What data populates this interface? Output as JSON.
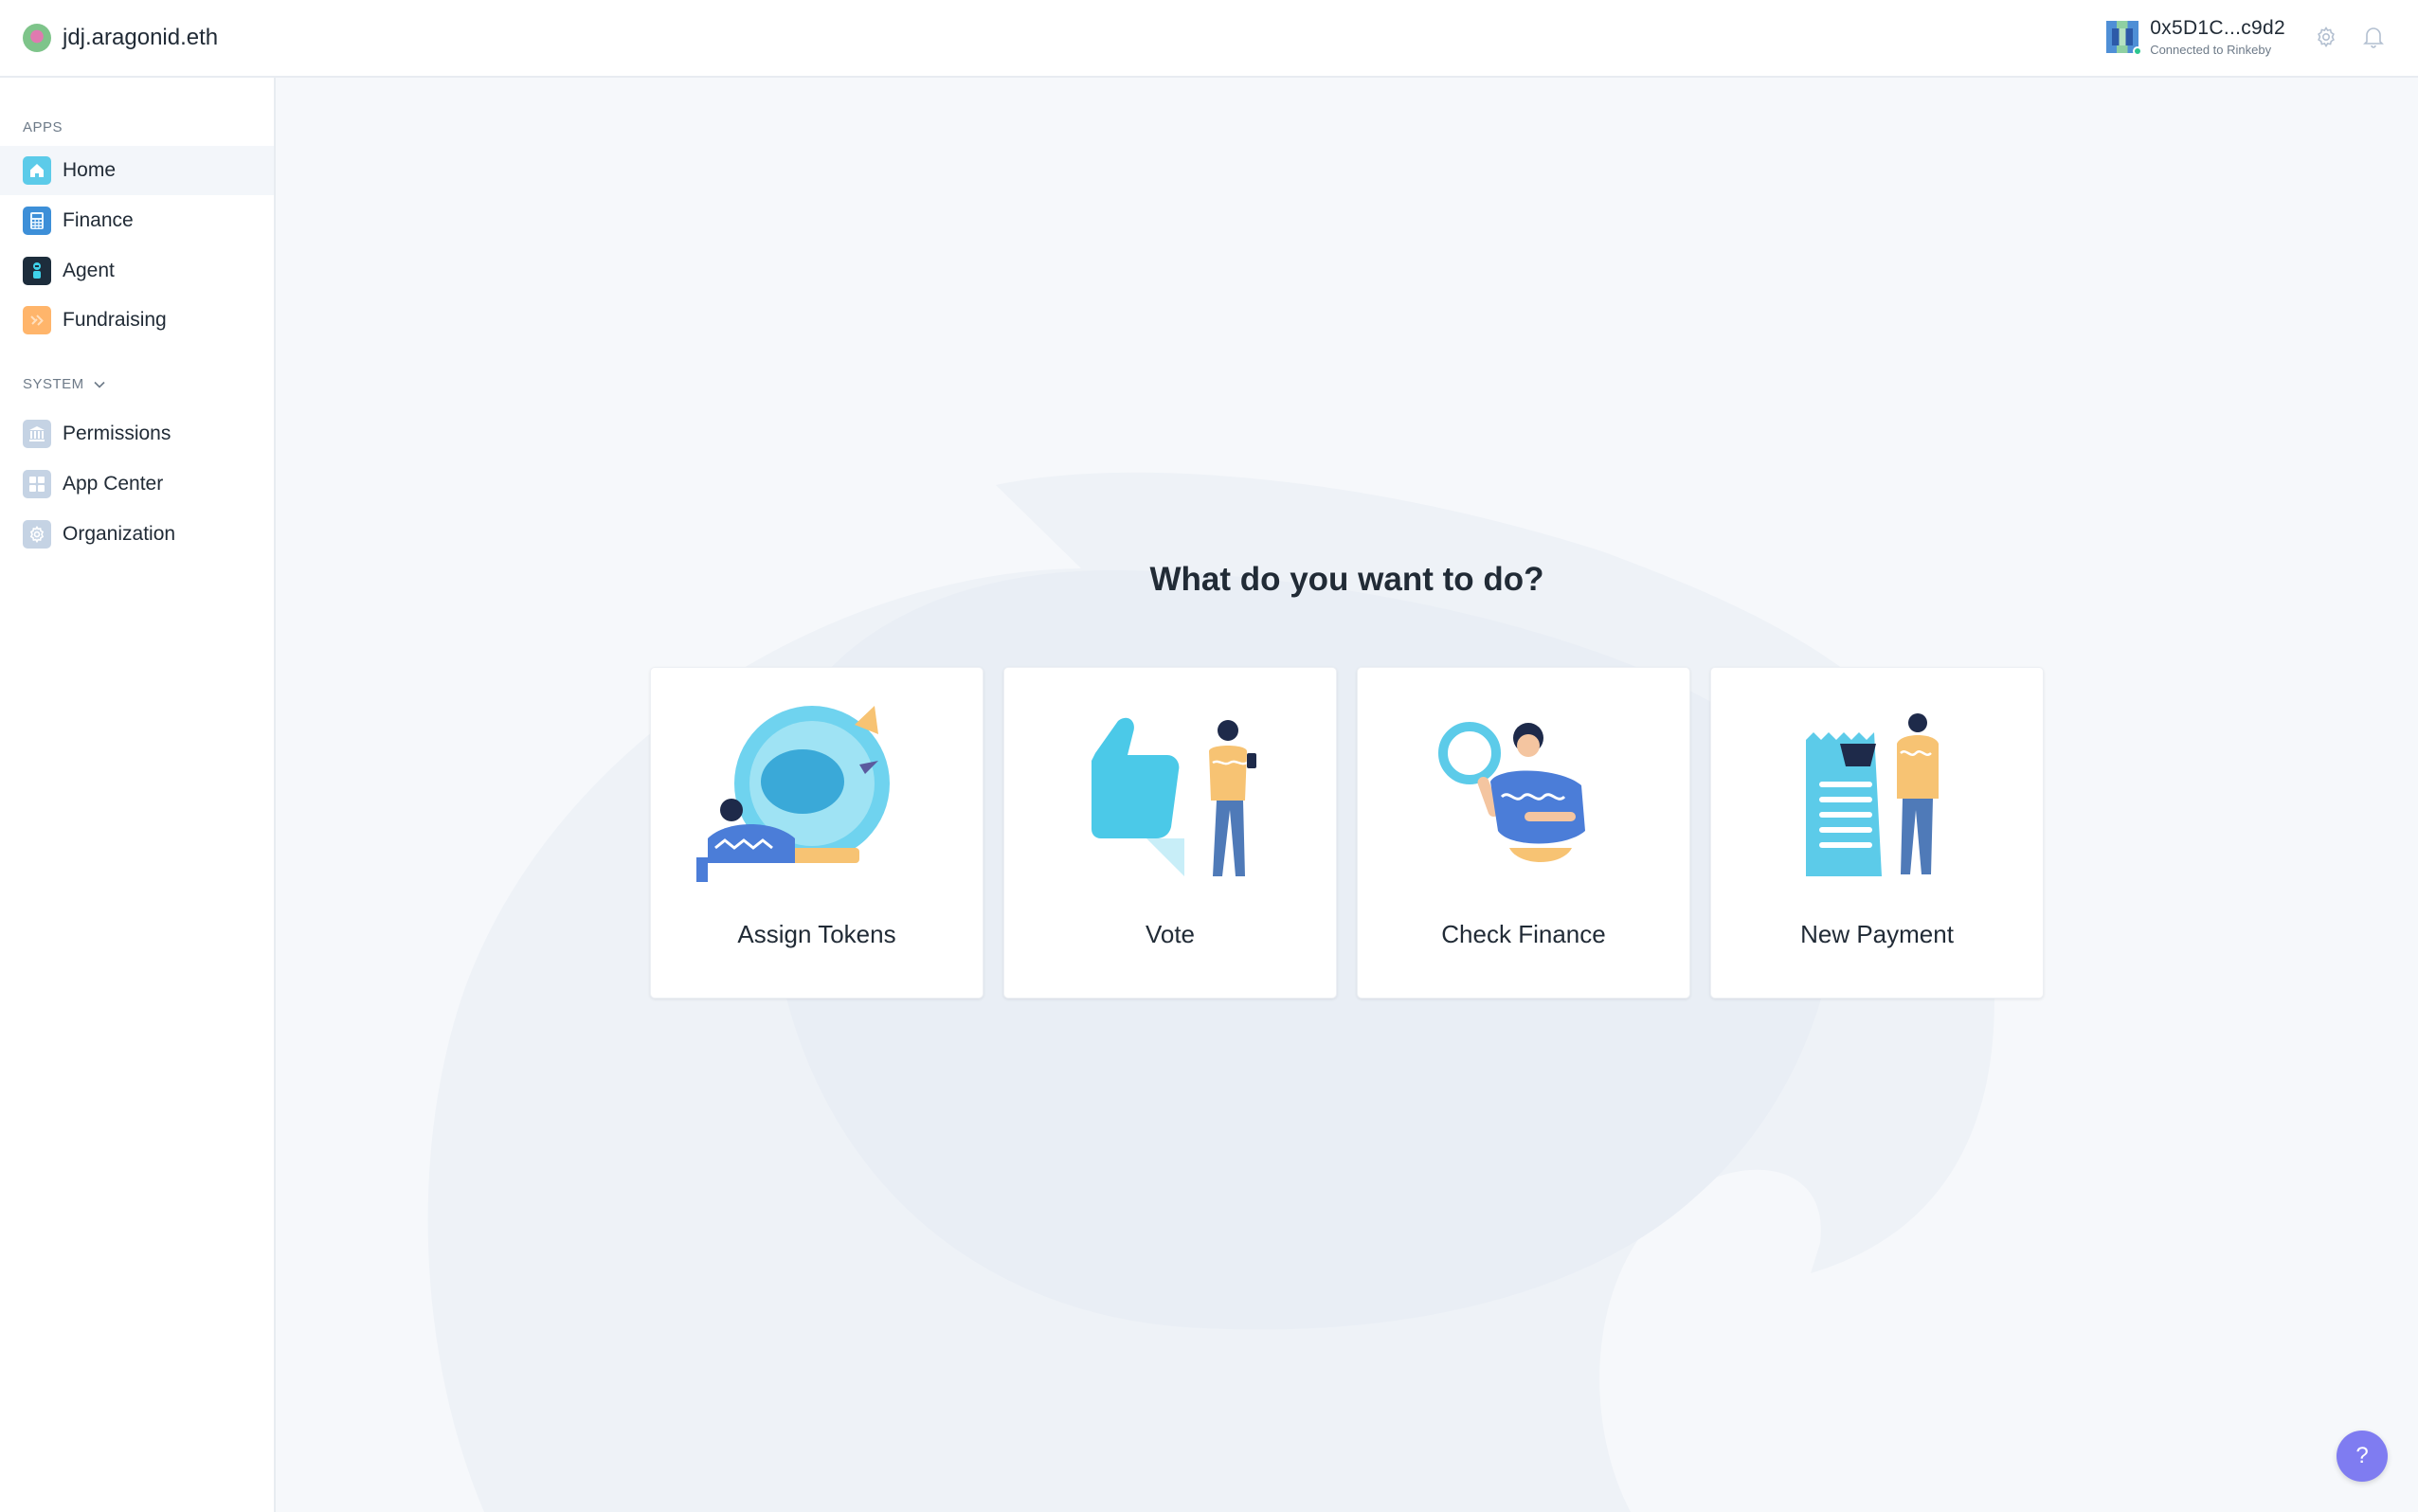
{
  "header": {
    "org_name": "jdj.aragonid.eth",
    "account_address": "0x5D1C...c9d2",
    "account_network": "Connected to Rinkeby",
    "icons": [
      "settings-icon",
      "notifications-icon"
    ]
  },
  "sidebar": {
    "apps_label": "APPS",
    "apps": [
      {
        "label": "Home",
        "icon": "home-icon",
        "color": "#5ccbe9",
        "active": true
      },
      {
        "label": "Finance",
        "icon": "finance-icon",
        "color": "#3d8fd8"
      },
      {
        "label": "Agent",
        "icon": "agent-icon",
        "color": "#1d2d3c"
      },
      {
        "label": "Fundraising",
        "icon": "fundraising-icon",
        "color": "#ffb56b"
      }
    ],
    "system_label": "SYSTEM",
    "system": [
      {
        "label": "Permissions",
        "icon": "permissions-icon",
        "color": "#c5d3e4"
      },
      {
        "label": "App Center",
        "icon": "app-center-icon",
        "color": "#c5d3e4"
      },
      {
        "label": "Organization",
        "icon": "organization-icon",
        "color": "#c5d3e4"
      }
    ]
  },
  "main": {
    "question": "What do you want to do?",
    "actions": [
      {
        "label": "Assign Tokens",
        "icon": "assign-tokens-illustration"
      },
      {
        "label": "Vote",
        "icon": "vote-illustration"
      },
      {
        "label": "Check Finance",
        "icon": "check-finance-illustration"
      },
      {
        "label": "New Payment",
        "icon": "new-payment-illustration"
      }
    ]
  },
  "help": {
    "label": "?"
  },
  "colors": {
    "accent": "#7f7cf1",
    "background": "#f6f8fb",
    "connected": "#2cc68f"
  }
}
